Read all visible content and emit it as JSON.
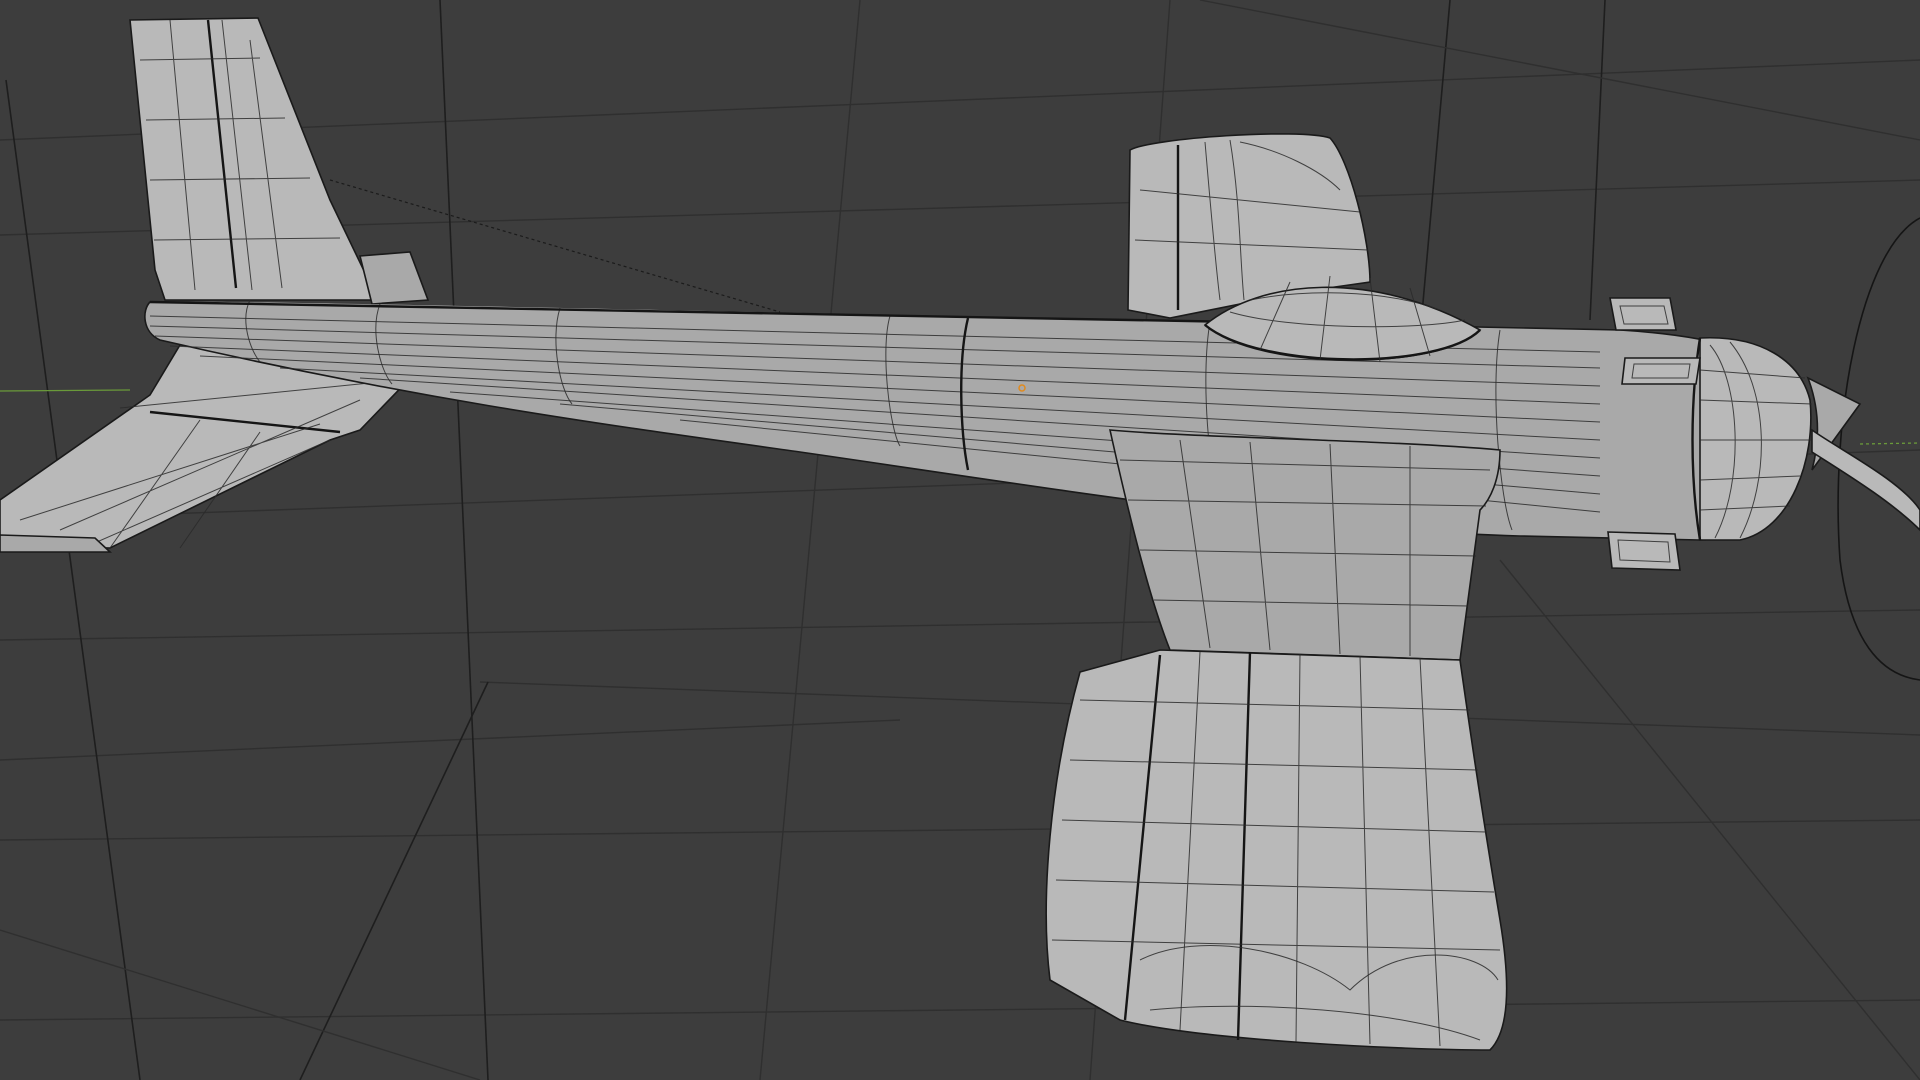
{
  "app": {
    "name": "",
    "view": "3D viewport"
  },
  "viewport": {
    "background_color": "#3d3d3d",
    "grid_color": "#2f2f2f",
    "object": {
      "description_icon": "airplane-mesh-icon",
      "shading": "solid",
      "overlay": "wireframe"
    },
    "x_axis_color": "#6a9a3a",
    "origin_color": "#e08a1e",
    "text_labels": []
  }
}
